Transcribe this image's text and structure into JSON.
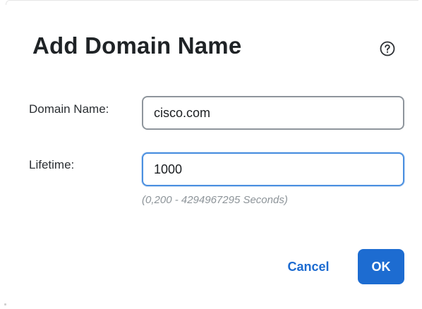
{
  "dialog": {
    "title": "Add Domain Name",
    "help_icon": "help-circle-icon"
  },
  "form": {
    "domain_name": {
      "label": "Domain Name:",
      "value": "cisco.com"
    },
    "lifetime": {
      "label": "Lifetime:",
      "value": "1000",
      "hint": "(0,200 - 4294967295 Seconds)"
    }
  },
  "actions": {
    "cancel_label": "Cancel",
    "ok_label": "OK"
  },
  "colors": {
    "primary": "#1d6cd1",
    "focus_border": "#4a8fe0",
    "hint_text": "#8d9499"
  }
}
